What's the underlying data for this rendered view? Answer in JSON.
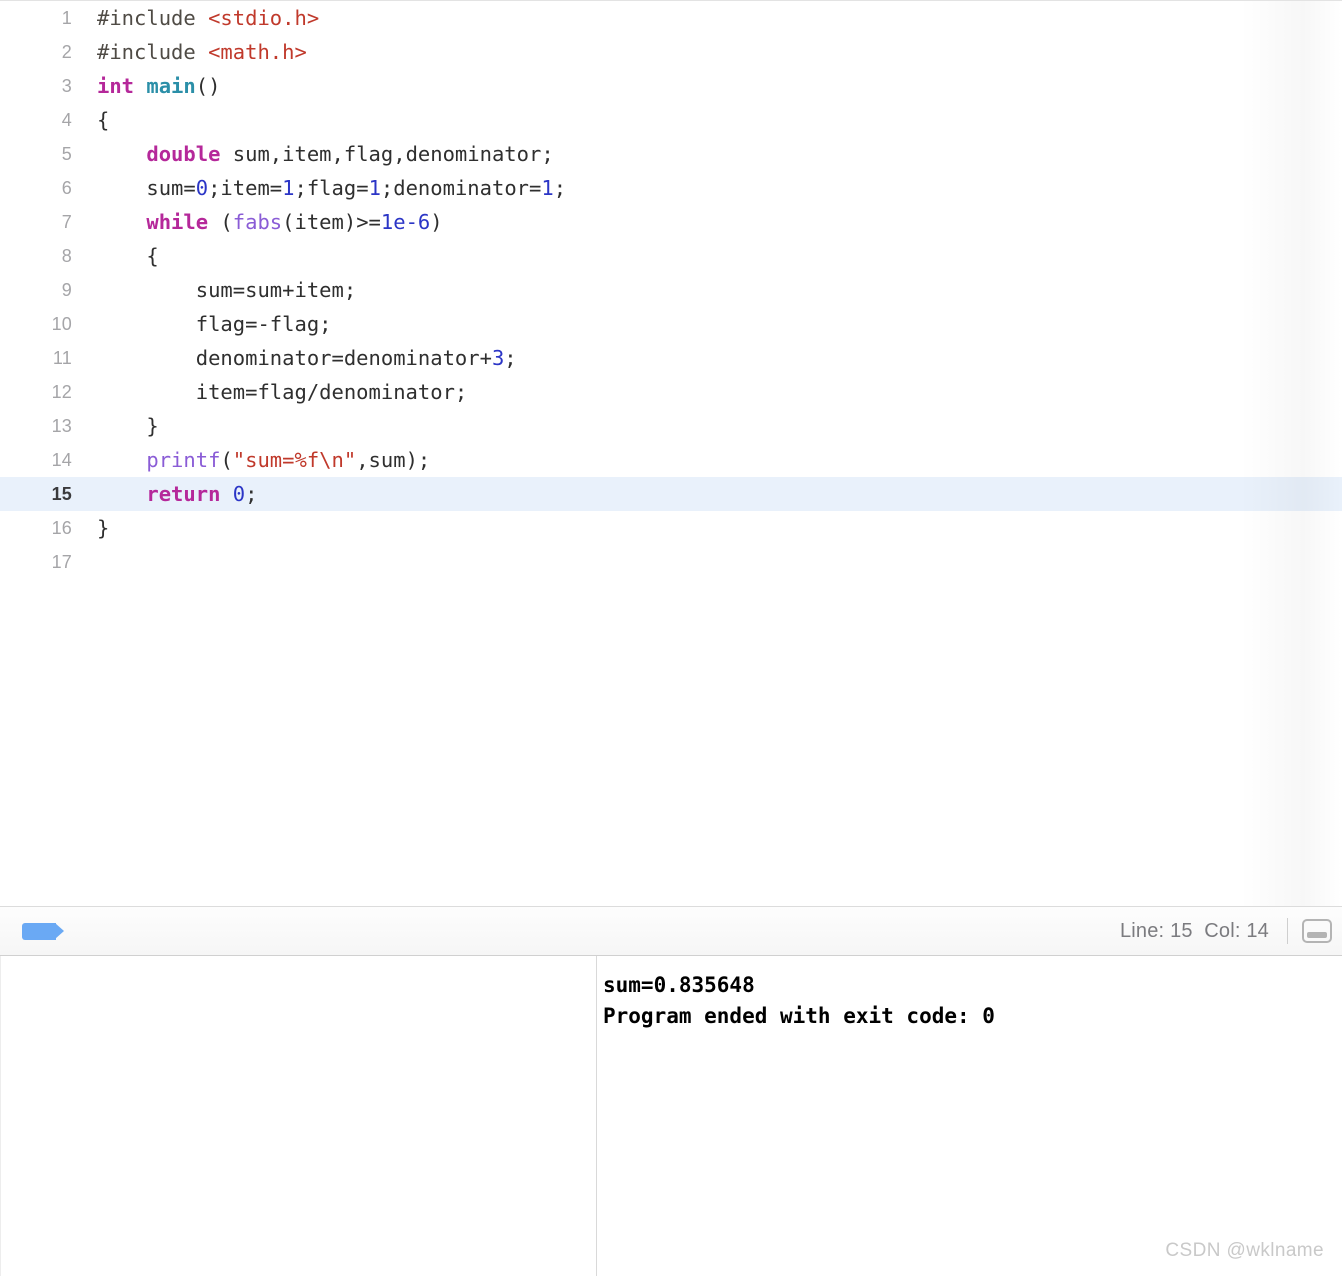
{
  "editor": {
    "language": "C",
    "current_line": 15,
    "lines": [
      {
        "number": "1",
        "tokens": [
          {
            "t": "pp",
            "v": "#include "
          },
          {
            "t": "hdr",
            "v": "<stdio.h>"
          }
        ]
      },
      {
        "number": "2",
        "tokens": [
          {
            "t": "pp",
            "v": "#include "
          },
          {
            "t": "hdr",
            "v": "<math.h>"
          }
        ]
      },
      {
        "number": "3",
        "tokens": [
          {
            "t": "kw",
            "v": "int"
          },
          {
            "t": "plain",
            "v": " "
          },
          {
            "t": "fnname",
            "v": "main"
          },
          {
            "t": "plain",
            "v": "()"
          }
        ]
      },
      {
        "number": "4",
        "tokens": [
          {
            "t": "plain",
            "v": "{"
          }
        ]
      },
      {
        "number": "5",
        "tokens": [
          {
            "t": "plain",
            "v": "    "
          },
          {
            "t": "kw",
            "v": "double"
          },
          {
            "t": "plain",
            "v": " sum,item,flag,denominator;"
          }
        ]
      },
      {
        "number": "6",
        "tokens": [
          {
            "t": "plain",
            "v": "    sum="
          },
          {
            "t": "num",
            "v": "0"
          },
          {
            "t": "plain",
            "v": ";item="
          },
          {
            "t": "num",
            "v": "1"
          },
          {
            "t": "plain",
            "v": ";flag="
          },
          {
            "t": "num",
            "v": "1"
          },
          {
            "t": "plain",
            "v": ";denominator="
          },
          {
            "t": "num",
            "v": "1"
          },
          {
            "t": "plain",
            "v": ";"
          }
        ]
      },
      {
        "number": "7",
        "tokens": [
          {
            "t": "plain",
            "v": "    "
          },
          {
            "t": "kw",
            "v": "while"
          },
          {
            "t": "plain",
            "v": " ("
          },
          {
            "t": "call",
            "v": "fabs"
          },
          {
            "t": "plain",
            "v": "(item)>="
          },
          {
            "t": "num",
            "v": "1e-6"
          },
          {
            "t": "plain",
            "v": ")"
          }
        ]
      },
      {
        "number": "8",
        "tokens": [
          {
            "t": "plain",
            "v": "    {"
          }
        ]
      },
      {
        "number": "9",
        "tokens": [
          {
            "t": "plain",
            "v": "        sum=sum+item;"
          }
        ]
      },
      {
        "number": "10",
        "tokens": [
          {
            "t": "plain",
            "v": "        flag=-flag;"
          }
        ]
      },
      {
        "number": "11",
        "tokens": [
          {
            "t": "plain",
            "v": "        denominator=denominator+"
          },
          {
            "t": "num",
            "v": "3"
          },
          {
            "t": "plain",
            "v": ";"
          }
        ]
      },
      {
        "number": "12",
        "tokens": [
          {
            "t": "plain",
            "v": "        item=flag/denominator;"
          }
        ]
      },
      {
        "number": "13",
        "tokens": [
          {
            "t": "plain",
            "v": "    }"
          }
        ]
      },
      {
        "number": "14",
        "tokens": [
          {
            "t": "plain",
            "v": "    "
          },
          {
            "t": "call",
            "v": "printf"
          },
          {
            "t": "plain",
            "v": "("
          },
          {
            "t": "str",
            "v": "\"sum=%f\\n\""
          },
          {
            "t": "plain",
            "v": ",sum);"
          }
        ]
      },
      {
        "number": "15",
        "tokens": [
          {
            "t": "plain",
            "v": "    "
          },
          {
            "t": "kw",
            "v": "return"
          },
          {
            "t": "plain",
            "v": " "
          },
          {
            "t": "num",
            "v": "0"
          },
          {
            "t": "plain",
            "v": ";"
          }
        ]
      },
      {
        "number": "16",
        "tokens": [
          {
            "t": "plain",
            "v": "}"
          }
        ]
      },
      {
        "number": "17",
        "tokens": [
          {
            "t": "plain",
            "v": ""
          }
        ]
      }
    ]
  },
  "status_bar": {
    "breadcrumb_tag": "breadcrumb-tag-icon",
    "position_label": "Line: 15  Col: 14",
    "line": "15",
    "col": "14",
    "console_toggle_icon": "console-panel-toggle-icon"
  },
  "console": {
    "output_lines": [
      "sum=0.835648",
      "Program ended with exit code: 0"
    ]
  },
  "watermark": {
    "text": "CSDN @wklname"
  },
  "colors": {
    "keyword": "#b5289a",
    "function_name": "#2b8fa8",
    "function_call": "#8a5cd6",
    "number": "#2b35c6",
    "string": "#c0392b",
    "header": "#c0392b",
    "preprocessor": "#4f4b45",
    "plain": "#2f2f2f",
    "current_line_highlight": "#e9f1fb",
    "breadcrumb_accent": "#6aa9f4"
  }
}
